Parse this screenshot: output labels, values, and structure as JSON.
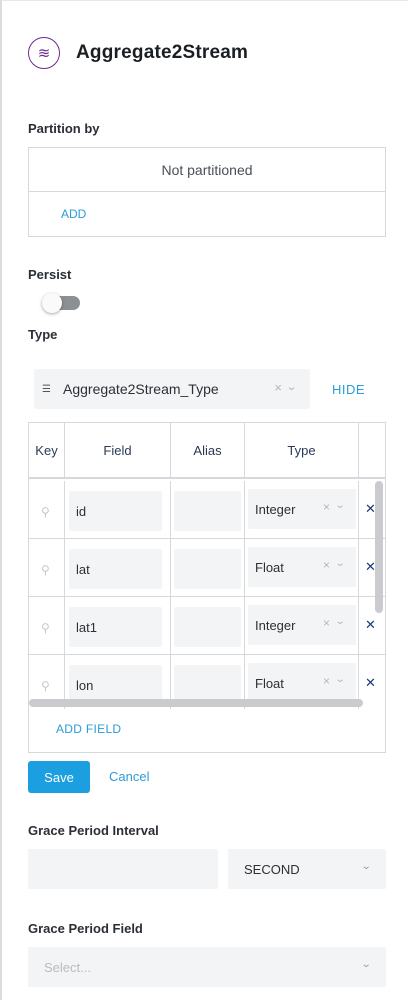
{
  "header": {
    "title": "Aggregate2Stream",
    "icon": "stream-waves-icon"
  },
  "partition": {
    "label": "Partition by",
    "empty_text": "Not partitioned",
    "add_label": "ADD"
  },
  "persist": {
    "label": "Persist",
    "enabled": false
  },
  "type": {
    "label": "Type",
    "selected": "Aggregate2Stream_Type",
    "hide_label": "HIDE"
  },
  "fields_table": {
    "columns": [
      "Key",
      "Field",
      "Alias",
      "Type"
    ],
    "rows": [
      {
        "field": "id",
        "alias": "",
        "type": "Integer"
      },
      {
        "field": "lat",
        "alias": "",
        "type": "Float"
      },
      {
        "field": "lat1",
        "alias": "",
        "type": "Integer"
      },
      {
        "field": "lon",
        "alias": "",
        "type": "Float"
      }
    ],
    "add_field_label": "ADD FIELD"
  },
  "actions": {
    "save_label": "Save",
    "cancel_label": "Cancel"
  },
  "grace_interval": {
    "label": "Grace Period Interval",
    "value": "",
    "unit": "SECOND"
  },
  "grace_field": {
    "label": "Grace Period Field",
    "placeholder": "Select..."
  },
  "colors": {
    "accent": "#1c9fe0",
    "link": "#2b9cd8",
    "brand": "#6b2c8f"
  }
}
